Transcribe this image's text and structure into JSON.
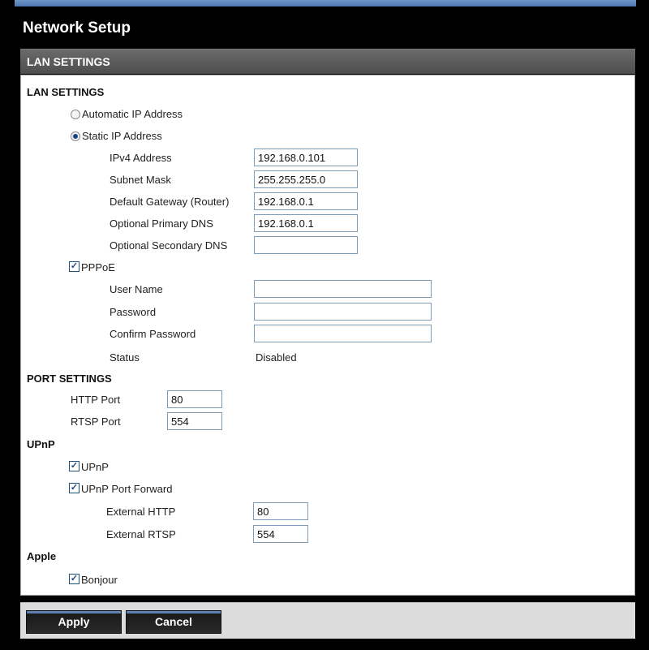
{
  "page_title": "Network Setup",
  "section_header": "LAN SETTINGS",
  "lan": {
    "heading": "LAN SETTINGS",
    "auto_ip_label": "Automatic IP Address",
    "static_ip_label": "Static IP Address",
    "selected_mode": "static",
    "ipv4_label": "IPv4 Address",
    "ipv4_value": "192.168.0.101",
    "subnet_label": "Subnet Mask",
    "subnet_value": "255.255.255.0",
    "gateway_label": "Default Gateway (Router)",
    "gateway_value": "192.168.0.1",
    "dns1_label": "Optional Primary DNS",
    "dns1_value": "192.168.0.1",
    "dns2_label": "Optional Secondary DNS",
    "dns2_value": ""
  },
  "pppoe": {
    "label": "PPPoE",
    "checked": true,
    "username_label": "User Name",
    "username_value": "",
    "password_label": "Password",
    "password_value": "",
    "confirm_label": "Confirm Password",
    "confirm_value": "",
    "status_label": "Status",
    "status_value": "Disabled"
  },
  "ports": {
    "heading": "PORT SETTINGS",
    "http_label": "HTTP Port",
    "http_value": "80",
    "rtsp_label": "RTSP Port",
    "rtsp_value": "554"
  },
  "upnp": {
    "heading": "UPnP",
    "upnp_label": "UPnP",
    "upnp_checked": true,
    "forward_label": "UPnP Port Forward",
    "forward_checked": true,
    "ext_http_label": "External HTTP",
    "ext_http_value": "80",
    "ext_rtsp_label": "External RTSP",
    "ext_rtsp_value": "554"
  },
  "apple": {
    "heading": "Apple",
    "bonjour_label": "Bonjour",
    "bonjour_checked": true
  },
  "buttons": {
    "apply": "Apply",
    "cancel": "Cancel"
  },
  "colors": {
    "header_bar": "#000000",
    "section_bar": "#5a5a5a",
    "accent_blue": "#5d7fb3"
  }
}
